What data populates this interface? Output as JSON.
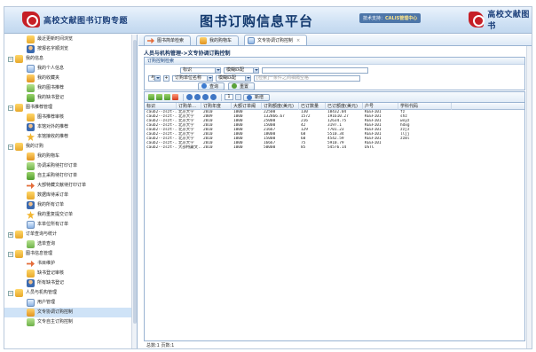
{
  "header": {
    "logo_text": "高校文献图书订购专题",
    "title": "图书订购信息平台",
    "support_label": "技术支持：",
    "support_brand": "CALIS管理中心",
    "logo_right_text": "高校文献图书"
  },
  "sidebar": {
    "items": [
      {
        "label": "最近更新时间浏览",
        "level": 1
      },
      {
        "label": "按报名字顺浏览",
        "level": 1
      },
      {
        "label": "我的信息",
        "level": 0,
        "expander": "−"
      },
      {
        "label": "我的个人信息",
        "level": 1
      },
      {
        "label": "我的收藏夹",
        "level": 1
      },
      {
        "label": "我的图书推荐",
        "level": 1
      },
      {
        "label": "我的缺书登记",
        "level": 1
      },
      {
        "label": "图书推荐管理",
        "level": 0,
        "expander": "−"
      },
      {
        "label": "图书推荐审核",
        "level": 1
      },
      {
        "label": "本馆对外的推荐",
        "level": 1
      },
      {
        "label": "本馆接收的推荐",
        "level": 1
      },
      {
        "label": "我的订购",
        "level": 0,
        "expander": "−"
      },
      {
        "label": "我的购物车",
        "level": 1
      },
      {
        "label": "协调采购待打印订单",
        "level": 1
      },
      {
        "label": "自主采购待打印订单",
        "level": 1
      },
      {
        "label": "大部特藏文献待打印订单",
        "level": 1
      },
      {
        "label": "数据库待采订单",
        "level": 1
      },
      {
        "label": "我的所有订单",
        "level": 1
      },
      {
        "label": "我的重复提交订单",
        "level": 1
      },
      {
        "label": "本单位所有订单",
        "level": 1
      },
      {
        "label": "订单查询与统计",
        "level": 0,
        "expander": "+"
      },
      {
        "label": "选单查询",
        "level": 1
      },
      {
        "label": "图书信息管理",
        "level": 0,
        "expander": "−"
      },
      {
        "label": "书目维护",
        "level": 1
      },
      {
        "label": "缺书登记审核",
        "level": 1
      },
      {
        "label": "所有缺书登记",
        "level": 1
      },
      {
        "label": "人员与机构管理",
        "level": 0,
        "expander": "−"
      },
      {
        "label": "用户管理",
        "level": 1
      },
      {
        "label": "文专协调订购控制",
        "level": 1,
        "selected": true
      },
      {
        "label": "文专自主订购控制",
        "level": 1
      }
    ]
  },
  "tabs": [
    {
      "label": "图书简单检索",
      "close": ""
    },
    {
      "label": "我的购物车",
      "close": ""
    },
    {
      "label": "文专协调订购控制",
      "close": "×"
    }
  ],
  "main": {
    "breadcrumb": "人员与机构管理->文专协调订购控制",
    "panel_title": "订购控制检索",
    "row1": {
      "field": "标识",
      "op": "模糊匹配",
      "value": ""
    },
    "row2": {
      "logic": "与",
      "field": "订购单位名称",
      "op": "模糊匹配",
      "placeholder": "[检索]一条件之间相隔空格"
    },
    "search_button": "查询",
    "reset_button": "重置",
    "page_value": "1",
    "action_button": "新增"
  },
  "grid": {
    "columns": [
      "标识",
      "订购单…",
      "订购年度",
      "大额订单阈",
      "订购额度(美元)",
      "已订数量",
      "已订额度(美元)",
      "户号",
      "学科代码"
    ],
    "rows": [
      [
        "caub2--zszt-...",
        "北京大学",
        "2010",
        "1000",
        "22500",
        "130",
        "18432.04",
        "KEEF101",
        "fz"
      ],
      [
        "caub2--zszt-...",
        "北京大学",
        "2009",
        "1000",
        "132866.67",
        "1572",
        "191610.27",
        "KEEF101",
        "shz"
      ],
      [
        "caub2--zszt-...",
        "北京大学",
        "2010",
        "1000",
        "25000",
        "216",
        "12634.75",
        "KEEF101",
        "wxyz"
      ],
      [
        "caub2--zszt-...",
        "北京大学",
        "2010",
        "1000",
        "15000",
        "42",
        "3197.1",
        "KEEF101",
        "hdxg"
      ],
      [
        "caub2--zszt-...",
        "北京大学",
        "2010",
        "1000",
        "21667",
        "129",
        "7701.23",
        "KEEF101",
        "zzjz"
      ],
      [
        "caub2--zszt-...",
        "北京大学",
        "2010",
        "1000",
        "18000",
        "68",
        "5510.34",
        "KEEF101",
        "lljj"
      ],
      [
        "caub2--zszt-...",
        "北京大学",
        "2010",
        "1000",
        "15000",
        "60",
        "4542.59",
        "KEEF101",
        "zzml"
      ],
      [
        "caub2--zszt-...",
        "北京大学",
        "2010",
        "1000",
        "16667",
        "75",
        "5910.79",
        "KEEF101",
        ""
      ],
      [
        "caub2--zszt-...",
        "大部特藏文...",
        "2010",
        "1000",
        "50000",
        "85",
        "54576.14",
        "DSTC",
        ""
      ]
    ]
  },
  "footer": "总数:1  页数:1"
}
